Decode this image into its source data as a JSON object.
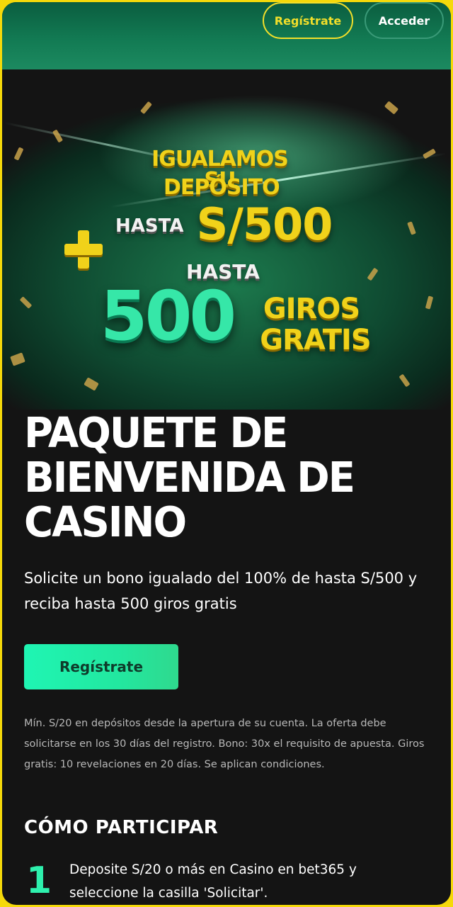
{
  "header": {
    "register_label": "Regístrate",
    "login_label": "Acceder"
  },
  "banner": {
    "line1": "IGUALAMOS SU",
    "line2": "DEPÓSITO",
    "upto1": "HASTA",
    "amount": "S/500",
    "plus_icon": "plus-icon",
    "upto2": "HASTA",
    "spins_count": "500",
    "spins_word1": "GIROS",
    "spins_word2": "GRATIS"
  },
  "offer": {
    "title": "PAQUETE DE BIENVENIDA DE CASINO",
    "subtitle": "Solicite un bono igualado del 100% de hasta S/500 y reciba hasta 500 giros gratis",
    "cta_label": "Regístrate",
    "terms": "Mín. S/20 en depósitos desde la apertura de su cuenta. La oferta debe solicitarse en los 30 días del registro. Bono: 30x el requisito de apuesta. Giros gratis: 10 revelaciones en 20 días. Se aplican condiciones."
  },
  "how_to": {
    "title": "CÓMO PARTICIPAR",
    "steps": [
      {
        "number": "1",
        "text": "Deposite S/20 o más en Casino en bet365 y seleccione la casilla 'Solicitar'."
      }
    ]
  },
  "colors": {
    "frame": "#f5d90a",
    "accent_green": "#2ef0ad",
    "gold": "#f0d21a",
    "background": "#141414"
  }
}
